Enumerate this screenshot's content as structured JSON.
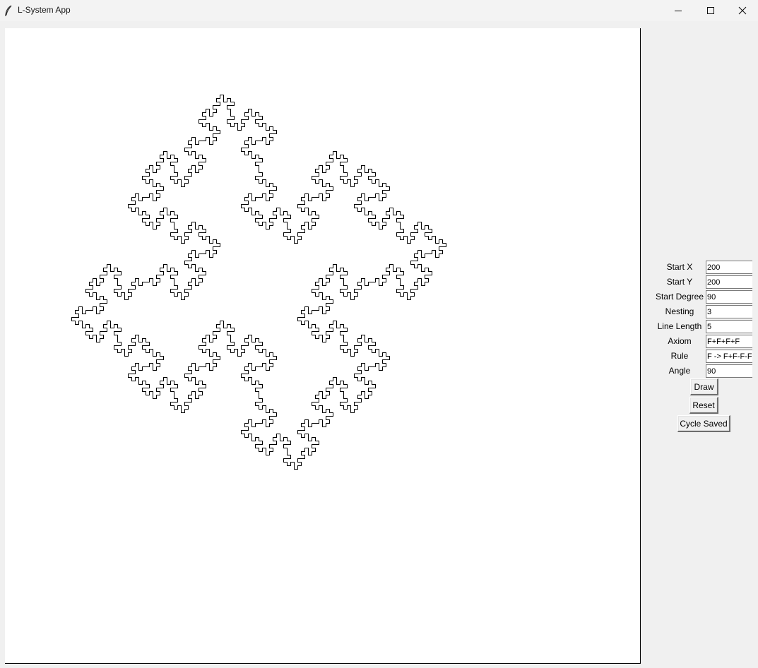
{
  "window": {
    "title": "L-System App"
  },
  "form": {
    "fields": [
      {
        "label": "Start X",
        "value": "200"
      },
      {
        "label": "Start Y",
        "value": "200"
      },
      {
        "label": "Start Degree",
        "value": "90"
      },
      {
        "label": "Nesting",
        "value": "3"
      },
      {
        "label": "Line Length",
        "value": "5"
      },
      {
        "label": "Axiom",
        "value": "F+F+F+F"
      },
      {
        "label": "Rule",
        "value": "F -> F+F-F-FF+F+F-F"
      },
      {
        "label": "Angle",
        "value": "90"
      }
    ],
    "buttons": {
      "draw": "Draw",
      "reset": "Reset",
      "cycle": "Cycle Saved"
    }
  },
  "drawing": {
    "axiom": "F+F+F+F",
    "rule_from": "F",
    "rule_to": "F+F-F-FF+F+F-F",
    "nesting": 3,
    "angle_deg": 90,
    "start_degree": 90,
    "line_length": 5,
    "stroke_color": "#000000"
  },
  "colors": {
    "canvas_bg": "#ffffff",
    "window_bg": "#f0f0f0"
  }
}
